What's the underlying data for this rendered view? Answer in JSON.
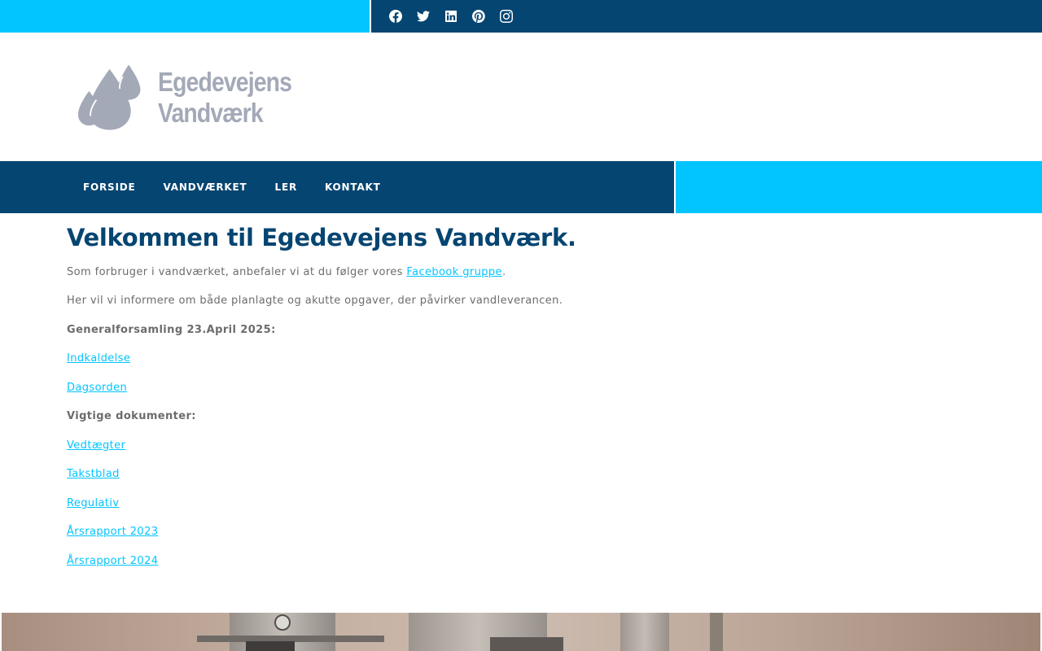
{
  "topbar": {
    "social": [
      {
        "name": "facebook-icon"
      },
      {
        "name": "twitter-icon"
      },
      {
        "name": "linkedin-icon"
      },
      {
        "name": "pinterest-icon"
      },
      {
        "name": "instagram-icon"
      }
    ]
  },
  "logo": {
    "line1": "Egedevejens",
    "line2": "Vandværk"
  },
  "nav": {
    "items": [
      {
        "label": "FORSIDE"
      },
      {
        "label": "VANDVÆRKET"
      },
      {
        "label": "LER"
      },
      {
        "label": "KONTAKT"
      }
    ]
  },
  "main": {
    "title": "Velkommen til Egedevejens Vandværk.",
    "intro_before": "Som forbruger i vandværket, anbefaler vi at du følger vores ",
    "intro_link": "Facebook gruppe",
    "intro_after": ".",
    "info": "Her vil vi informere om både planlagte og akutte opgaver, der påvirker vandleverancen.",
    "assembly_heading": "Generalforsamling 23.April 2025:",
    "assembly_links": [
      "Indkaldelse",
      "Dagsorden"
    ],
    "docs_heading": "Vigtige dokumenter:",
    "doc_links": [
      "Vedtægter",
      "Takstblad",
      "Regulativ",
      "Årsrapport 2023",
      "Årsrapport 2024"
    ]
  },
  "colors": {
    "primary": "#054571",
    "accent": "#02c5ff",
    "text": "#6c6c6c",
    "logo": "#a3a9b7"
  }
}
